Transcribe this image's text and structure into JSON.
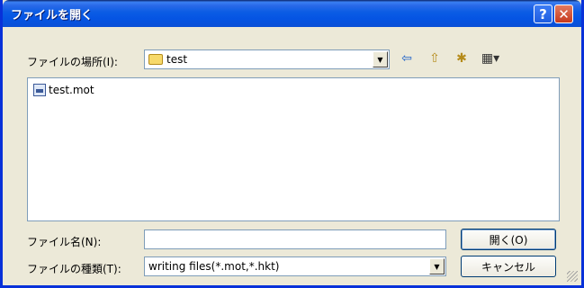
{
  "window": {
    "title": "ファイルを開く"
  },
  "titlebar": {
    "help_glyph": "?",
    "close_glyph": "✕"
  },
  "location": {
    "label": "ファイルの場所(I):",
    "value": "test",
    "toolbar_icons": [
      "back-arrow-icon",
      "up-folder-icon",
      "new-folder-icon",
      "view-menu-icon"
    ]
  },
  "file_list": {
    "items": [
      {
        "name": "test.mot",
        "icon": "document-icon"
      }
    ]
  },
  "filename": {
    "label": "ファイル名(N):",
    "value": ""
  },
  "filetype": {
    "label": "ファイルの種類(T):",
    "value": "writing files(*.mot,*.hkt)"
  },
  "buttons": {
    "open": "開く(O)",
    "cancel": "キャンセル"
  },
  "glyphs": {
    "dropdown": "▼",
    "back": "⇦",
    "up": "⇧",
    "new": "✱",
    "view": "▦▾"
  },
  "colors": {
    "titlebar": "#0554e3",
    "dialog_bg": "#ece9d8",
    "border": "#0831d9"
  }
}
